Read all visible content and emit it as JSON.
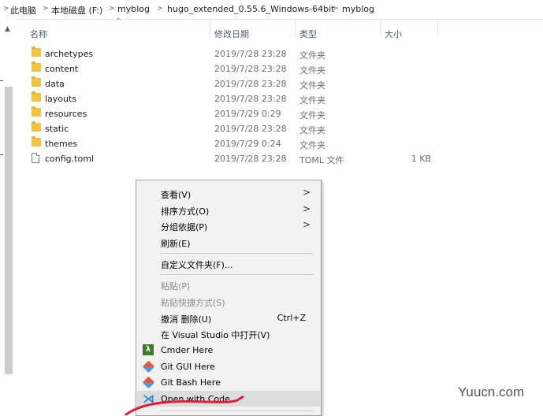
{
  "breadcrumb": {
    "items": [
      "此电脑",
      "本地磁盘 (F:)",
      "myblog",
      "hugo_extended_0.55.6_Windows-64bit",
      "myblog"
    ],
    "separator": ">"
  },
  "columns": {
    "name": "名称",
    "date": "修改日期",
    "type": "类型",
    "size": "大小"
  },
  "files": [
    {
      "name": "archetypes",
      "date": "2019/7/28 23:28",
      "type": "文件夹",
      "size": "",
      "icon": "folder-icon"
    },
    {
      "name": "content",
      "date": "2019/7/28 23:28",
      "type": "文件夹",
      "size": "",
      "icon": "folder-icon"
    },
    {
      "name": "data",
      "date": "2019/7/28 23:28",
      "type": "文件夹",
      "size": "",
      "icon": "folder-icon"
    },
    {
      "name": "layouts",
      "date": "2019/7/28 23:28",
      "type": "文件夹",
      "size": "",
      "icon": "folder-icon"
    },
    {
      "name": "resources",
      "date": "2019/7/29 0:29",
      "type": "文件夹",
      "size": "",
      "icon": "folder-icon"
    },
    {
      "name": "static",
      "date": "2019/7/28 23:28",
      "type": "文件夹",
      "size": "",
      "icon": "folder-icon"
    },
    {
      "name": "themes",
      "date": "2019/7/29 0:24",
      "type": "文件夹",
      "size": "",
      "icon": "folder-icon"
    },
    {
      "name": "config.toml",
      "date": "2019/7/28 23:28",
      "type": "TOML 文件",
      "size": "1 KB",
      "icon": "file-icon"
    }
  ],
  "context_menu": {
    "items": [
      {
        "label": "查看(V)",
        "submenu": true
      },
      {
        "label": "排序方式(O)",
        "submenu": true
      },
      {
        "label": "分组依据(P)",
        "submenu": true
      },
      {
        "label": "刷新(E)"
      },
      {
        "label": "自定义文件夹(F)..."
      },
      {
        "label": "粘贴(P)",
        "disabled": true
      },
      {
        "label": "粘贴快捷方式(S)",
        "disabled": true
      },
      {
        "label": "撤消 删除(U)",
        "shortcut": "Ctrl+Z"
      },
      {
        "label": "在 Visual Studio 中打开(V)"
      },
      {
        "label": "Cmder Here",
        "icon": "cmder-icon"
      },
      {
        "label": "Git GUI Here",
        "icon": "git-icon"
      },
      {
        "label": "Git Bash Here",
        "icon": "git-icon"
      },
      {
        "label": "Open with Code",
        "icon": "vscode-icon",
        "highlighted": true
      }
    ]
  },
  "watermark": "Yuucn.com",
  "colors": {
    "annotation": "#e0203a",
    "menu_bg": "#f2f2f2",
    "menu_hover": "#dcdcdc",
    "folder": "#f3c244"
  }
}
